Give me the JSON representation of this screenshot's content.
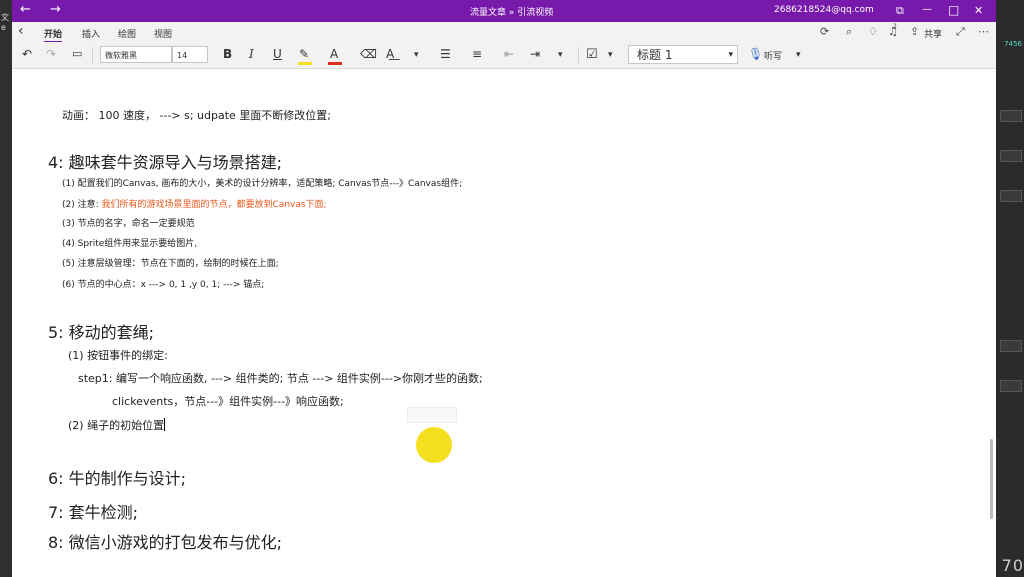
{
  "background": {
    "left_text": "文e",
    "right_text": "7456",
    "corner_text": "70"
  },
  "titlebar": {
    "back_glyph": "←",
    "forward_glyph": "→",
    "title": "流量文章 » 引流视频",
    "account": "2686218524@qq.com",
    "restore_glyph": "⧉",
    "minimize_glyph": "—",
    "maximize_glyph": "□",
    "close_glyph": "✕"
  },
  "menubar": {
    "back_glyph": "‹",
    "tabs": [
      "开始",
      "插入",
      "绘图",
      "视图"
    ],
    "notification_count": "2",
    "share_label": "共享"
  },
  "toolbar": {
    "font_name": "微软雅黑",
    "font_size": "14",
    "bold": "B",
    "italic": "I",
    "underline": "U",
    "font_color_letter": "A",
    "style_value": "标题 1",
    "dictate_label": "听写",
    "highlight_color": "#f6e021",
    "font_color": "#e0301e"
  },
  "content": {
    "line1": "动画： 100 速度， ---> s;  udpate 里面不断修改位置;",
    "heading4": "4: 趣味套牛资源导入与场景搭建;",
    "item4_1": "(1) 配置我们的Canvas, 画布的大小，美术的设计分辨率，适配策略; Canvas节点---》Canvas组件;",
    "item4_2_prefix": "(2) 注意: ",
    "item4_2_body": "我们所有的游戏场景里面的节点，都要放到Canvas下面;",
    "item4_3": "(3) 节点的名字，命名一定要规范",
    "item4_4": "(4)  Sprite组件用来显示要给图片,",
    "item4_5": "(5) 注意层级管理：节点在下面的，绘制的时候在上面;",
    "item4_6": "(6) 节点的中心点：x ---> 0, 1 ,y   0, 1;  ---> 锚点;",
    "heading5": "5: 移动的套绳;",
    "item5_1": "(1) 按钮事件的绑定:",
    "step1": "step1: 编写一个响应函数, ---> 组件类的;    节点 ---> 组件实例--->你刚才些的函数;",
    "clickevents": "clickevents，节点---》组件实例---》响应函数;",
    "item5_2": "(2) 绳子的初始位置",
    "heading6": "6: 牛的制作与设计;",
    "heading7": "7: 套牛检测;",
    "heading8": "8: 微信小游戏的打包发布与优化;"
  }
}
